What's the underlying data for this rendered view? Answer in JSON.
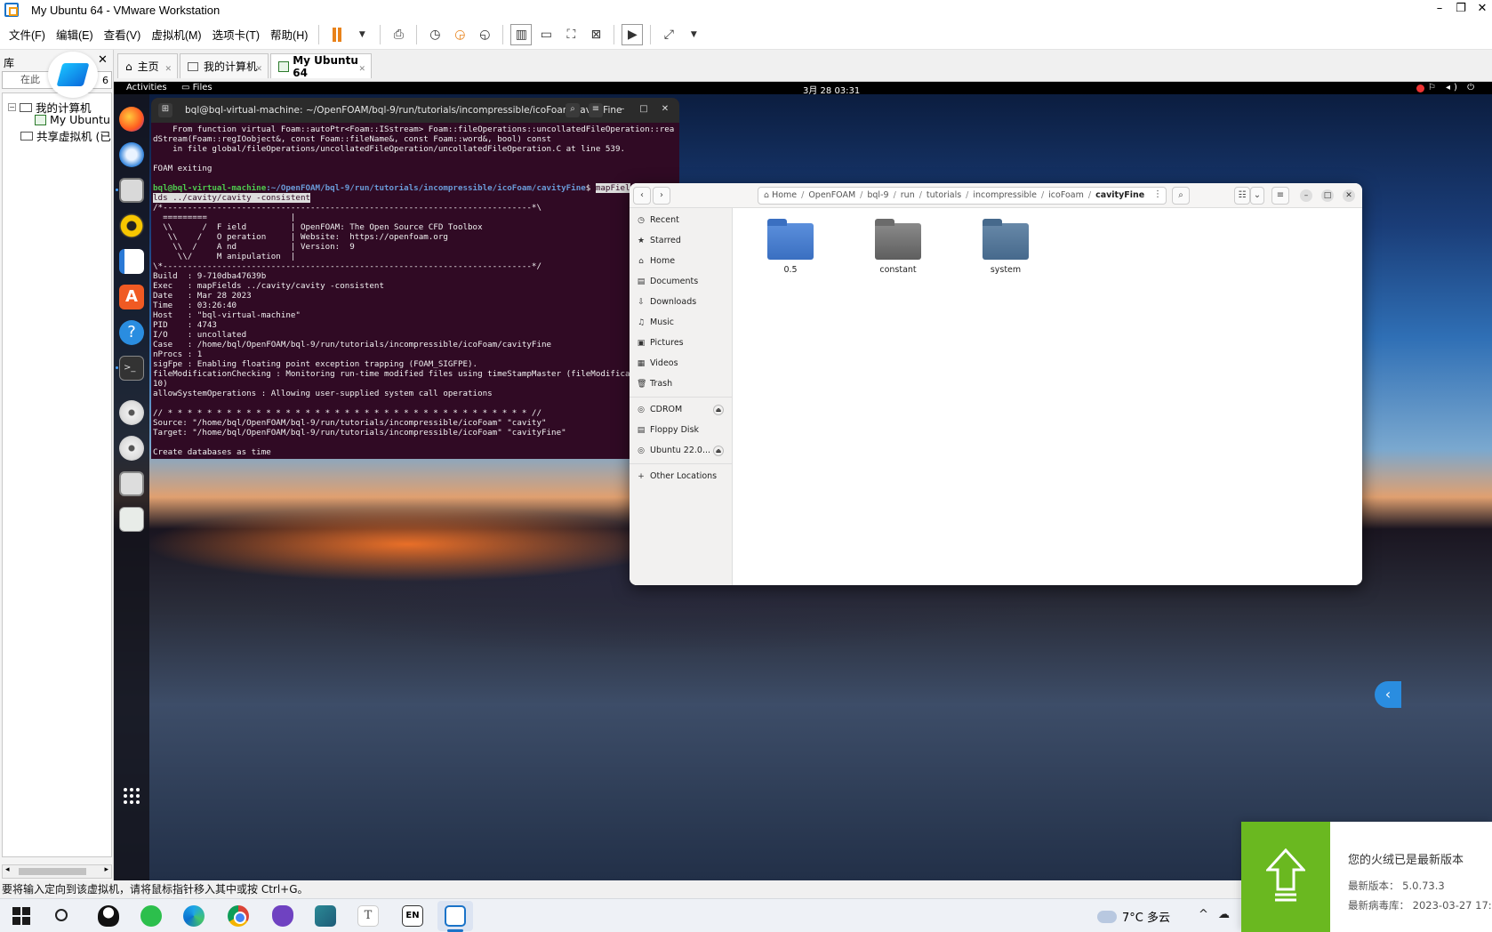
{
  "window": {
    "title": "My Ubuntu 64 - VMware Workstation",
    "controls": [
      "–",
      "❐",
      "✕"
    ]
  },
  "menubar": {
    "items": [
      "文件(F)",
      "编辑(E)",
      "查看(V)",
      "虚拟机(M)",
      "选项卡(T)",
      "帮助(H)"
    ]
  },
  "library": {
    "title": "库",
    "close": "✕",
    "search_placeholder": "在此",
    "count": "6",
    "tree": {
      "my_computer": "我的计算机",
      "vm": "My Ubuntu",
      "shared": "共享虚拟机 (已弃"
    }
  },
  "tabs": [
    {
      "label": "主页"
    },
    {
      "label": "我的计算机"
    },
    {
      "label": "My Ubuntu 64"
    }
  ],
  "gnome": {
    "activities": "Activities",
    "app": "Files",
    "clock": "3月 28 03:31",
    "tray": "⚐ ◂) ⏻"
  },
  "terminal": {
    "title": "bql@bql-virtual-machine: ~/OpenFOAM/bql-9/run/tutorials/incompressible/icoFoam/cavityFine",
    "lines_pre": [
      "    From function virtual Foam::autoPtr<Foam::ISstream> Foam::fileOperations::uncollatedFileOperation::rea",
      "dStream(Foam::regIOobject&, const Foam::fileName&, const Foam::word&, bool) const",
      "    in file global/fileOperations/uncollatedFileOperation/uncollatedFileOperation.C at line 539.",
      "",
      "FOAM exiting",
      ""
    ],
    "prompt_user": "bql@bql-virtual-machine",
    "prompt_path": ":~/OpenFOAM/bql-9/run/tutorials/incompressible/icoFoam/cavityFine",
    "prompt_dollar": "$ ",
    "command_1": "mapFiel",
    "command_2": "lds ../cavity/cavity -consistent",
    "lines_post": [
      "/*---------------------------------------------------------------------------*\\",
      "  =========                 |",
      "  \\\\      /  F ield         | OpenFOAM: The Open Source CFD Toolbox",
      "   \\\\    /   O peration     | Website:  https://openfoam.org",
      "    \\\\  /    A nd           | Version:  9",
      "     \\\\/     M anipulation  |",
      "\\*---------------------------------------------------------------------------*/",
      "Build  : 9-710dba47639b",
      "Exec   : mapFields ../cavity/cavity -consistent",
      "Date   : Mar 28 2023",
      "Time   : 03:26:40",
      "Host   : \"bql-virtual-machine\"",
      "PID    : 4743",
      "I/O    : uncollated",
      "Case   : /home/bql/OpenFOAM/bql-9/run/tutorials/incompressible/icoFoam/cavityFine",
      "nProcs : 1",
      "sigFpe : Enabling floating point exception trapping (FOAM_SIGFPE).",
      "fileModificationChecking : Monitoring run-time modified files using timeStampMaster (fileModifica",
      "10)",
      "allowSystemOperations : Allowing user-supplied system call operations",
      "",
      "// * * * * * * * * * * * * * * * * * * * * * * * * * * * * * * * * * * * * * //",
      "Source: \"/home/bql/OpenFOAM/bql-9/run/tutorials/incompressible/icoFoam\" \"cavity\"",
      "Target: \"/home/bql/OpenFOAM/bql-9/run/tutorials/incompressible/icoFoam\" \"cavityFine\"",
      "",
      "Create databases as time"
    ]
  },
  "files": {
    "breadcrumb": [
      "Home",
      "OpenFOAM",
      "bql-9",
      "run",
      "tutorials",
      "incompressible",
      "icoFoam"
    ],
    "current": "cavityFine",
    "sidebar": {
      "recent": "Recent",
      "starred": "Starred",
      "home": "Home",
      "documents": "Documents",
      "downloads": "Downloads",
      "music": "Music",
      "pictures": "Pictures",
      "videos": "Videos",
      "trash": "Trash",
      "cdrom": "CDROM",
      "floppy": "Floppy Disk",
      "ubuntu": "Ubuntu 22.0...",
      "other": "Other Locations"
    },
    "folders": [
      "0.5",
      "constant",
      "system"
    ]
  },
  "statusbar": "要将输入定向到该虚拟机，请将鼠标指针移入其中或按 Ctrl+G。",
  "taskbar": {
    "weather": "7°C 多云",
    "tray_chevron": "^",
    "en": "EN",
    "typora": "T"
  },
  "notification": {
    "title": "您的火绒已是最新版本",
    "version": "最新版本：  5.0.73.3",
    "db": "最新病毒库：  2023-03-27 17:"
  }
}
